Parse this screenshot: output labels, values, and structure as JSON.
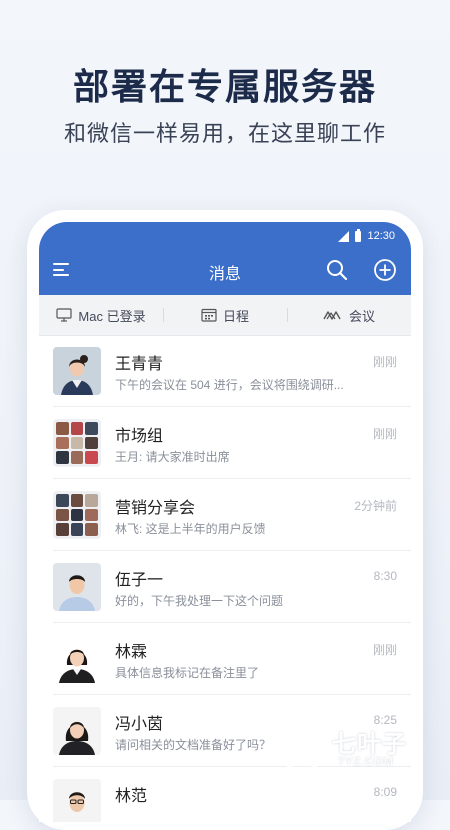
{
  "hero": {
    "title": "部署在专属服务器",
    "subtitle": "和微信一样易用，在这里聊工作"
  },
  "status_bar": {
    "time": "12:30"
  },
  "nav": {
    "title": "消息",
    "menu_icon": "menu-icon",
    "search_icon": "search-icon",
    "add_icon": "add-circle-icon"
  },
  "quickbar": {
    "items": [
      {
        "label": "Mac 已登录",
        "icon": "monitor-icon"
      },
      {
        "label": "日程",
        "icon": "calendar-icon"
      },
      {
        "label": "会议",
        "icon": "meeting-icon"
      }
    ]
  },
  "chats": [
    {
      "name": "王青青",
      "preview": "下午的会议在 504 进行，会议将围绕调研...",
      "time": "刚刚"
    },
    {
      "name": "市场组",
      "preview": "王月: 请大家准时出席",
      "time": "刚刚"
    },
    {
      "name": "营销分享会",
      "preview": "林飞: 这是上半年的用户反馈",
      "time": "2分钟前"
    },
    {
      "name": "伍子一",
      "preview": "好的，下午我处理一下这个问题",
      "time": "8:30"
    },
    {
      "name": "林霖",
      "preview": "具体信息我标记在备注里了",
      "time": "刚刚"
    },
    {
      "name": "冯小茵",
      "preview": "请问相关的文档准备好了吗？",
      "time": "8:25"
    },
    {
      "name": "林范",
      "preview": "",
      "time": "8:09"
    }
  ],
  "watermark": {
    "brand": "七叶子",
    "url": "7YZ.COM"
  },
  "colors": {
    "brand_blue": "#3b6fc9",
    "hero_title": "#1d2b4a"
  }
}
